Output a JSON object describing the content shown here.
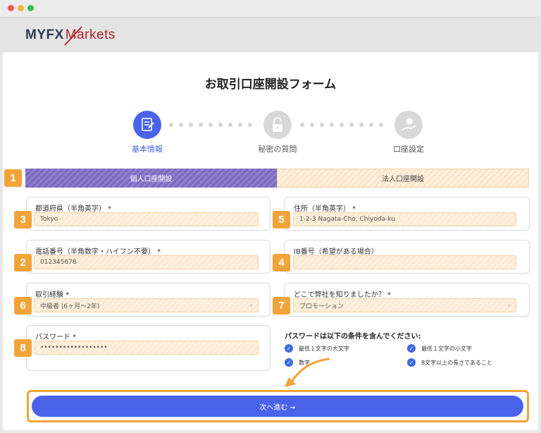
{
  "brand": {
    "logo_primary": "MYFX",
    "logo_secondary": "Markets"
  },
  "page": {
    "title": "お取引口座開設フォーム"
  },
  "steps": [
    {
      "label": "基本情報",
      "state": "active",
      "icon": "document-icon"
    },
    {
      "label": "秘密の質問",
      "state": "pending",
      "icon": "lock-icon"
    },
    {
      "label": "口座設定",
      "state": "pending",
      "icon": "hand-coin-icon"
    }
  ],
  "tabs": {
    "individual": "個人口座開設",
    "corporate": "法人口座開設"
  },
  "badges": {
    "b1": "1",
    "b2": "2",
    "b3": "3",
    "b4": "4",
    "b5": "5",
    "b6": "6",
    "b7": "7",
    "b8": "8"
  },
  "fields": {
    "prefecture": {
      "label": "都道府県（半角英字） *",
      "value": "Tokyo"
    },
    "address": {
      "label": "住所（半角英字） *",
      "value": "1-2-3 Nagata-Cho, Chiyoda-ku"
    },
    "phone": {
      "label": "電話番号（半角数字・ハイフン不要） *",
      "value": "012345678"
    },
    "ib": {
      "label": "IB番号（希望がある場合）",
      "value": ""
    },
    "experience": {
      "label": "取引経験 *",
      "value": "中級者 (6ヶ月〜2年)"
    },
    "referral": {
      "label": "どこで弊社を知りましたか？ *",
      "value": "プロモーション"
    },
    "password": {
      "label": "パスワード *",
      "value": "••••••••••••••••••"
    }
  },
  "password_rules": {
    "title": "パスワードは以下の条件を含んでください:",
    "items": [
      "最低１文字の大文字",
      "最低１文字の小文字",
      "数字",
      "8文字以上の長さであること"
    ]
  },
  "submit": {
    "label": "次へ進む ➞"
  },
  "colors": {
    "accent": "#4a63eb",
    "badge": "#f2a33a",
    "tab_active": "#7b6ac0",
    "check": "#4169e1"
  }
}
